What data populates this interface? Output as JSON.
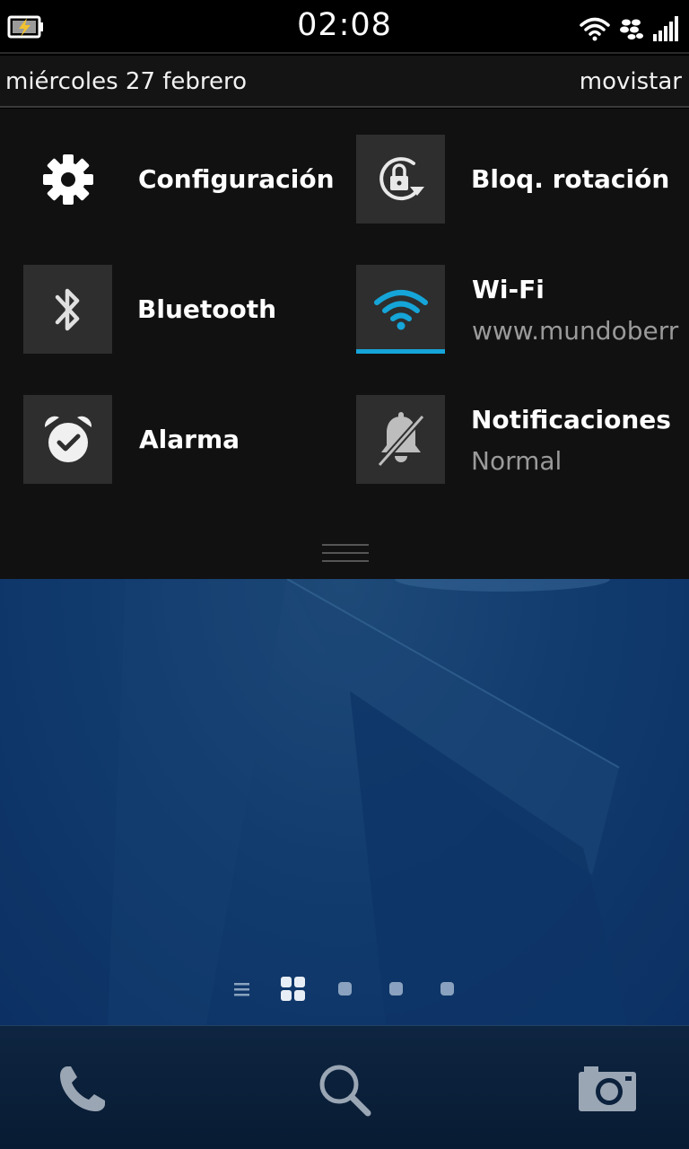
{
  "status_bar": {
    "time": "02:08",
    "icons": [
      "battery-charging-icon",
      "wifi-signal-icon",
      "blackberry-icon",
      "cellular-signal-icon"
    ]
  },
  "date_bar": {
    "date": "miércoles 27 febrero",
    "carrier": "movistar"
  },
  "quick_settings": {
    "settings": {
      "label": "Configuración",
      "icon": "gear-icon"
    },
    "rotation_lock": {
      "label": "Bloq. rotación",
      "icon": "rotation-lock-icon"
    },
    "bluetooth": {
      "label": "Bluetooth",
      "icon": "bluetooth-icon"
    },
    "wifi": {
      "label": "Wi-Fi",
      "network": "www.mundoberr",
      "icon": "wifi-icon",
      "active_color": "#15a5d8"
    },
    "alarm": {
      "label": "Alarma",
      "icon": "alarm-clock-icon"
    },
    "notifications": {
      "label": "Notificaciones",
      "mode": "Normal",
      "icon": "bell-muted-icon"
    }
  },
  "pager": {
    "pages": [
      "list-icon",
      "grid-icon",
      "page-dot",
      "page-dot",
      "page-dot"
    ],
    "active": 1
  },
  "dock": {
    "buttons": [
      "phone-icon",
      "search-icon",
      "camera-icon"
    ]
  },
  "colors": {
    "accent": "#15a5d8",
    "panel_bg": "#111111",
    "tile_bg": "#2e2e2e",
    "wallpaper": "#0c3063"
  }
}
